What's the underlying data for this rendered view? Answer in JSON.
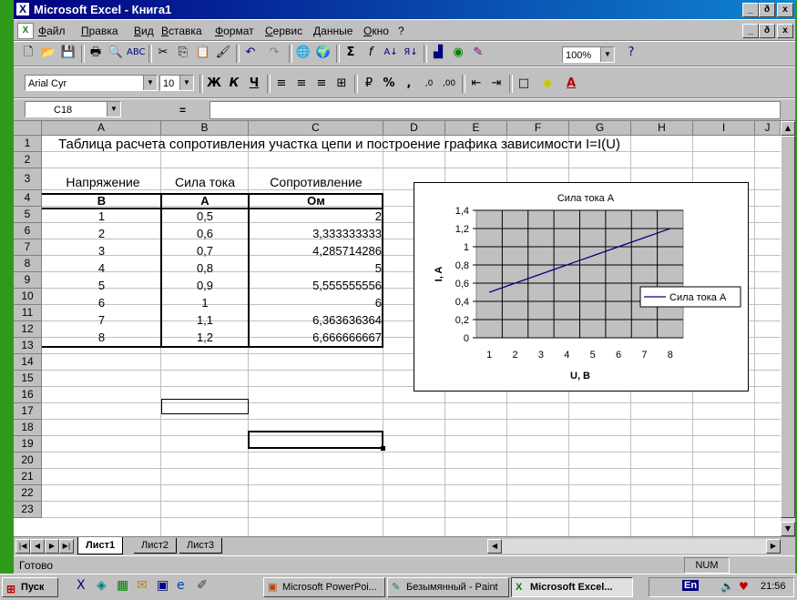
{
  "window": {
    "title": "Microsoft Excel - Книга1",
    "min": "_",
    "max": "ð",
    "close": "x"
  },
  "menu": [
    "Файл",
    "Правка",
    "Вид",
    "Вставка",
    "Формат",
    "Сервис",
    "Данные",
    "Окно",
    "?"
  ],
  "toolbar": {
    "zoom": "100%",
    "font": "Arial Cyr",
    "size": "10"
  },
  "formula_bar": {
    "name_box": "C18",
    "equals": "="
  },
  "columns": [
    "A",
    "B",
    "C",
    "D",
    "E",
    "F",
    "G",
    "H",
    "I",
    "J"
  ],
  "rows": [
    "1",
    "2",
    "3",
    "4",
    "5",
    "6",
    "7",
    "8",
    "9",
    "10",
    "11",
    "12",
    "13",
    "14",
    "15",
    "16",
    "17",
    "18",
    "19",
    "20",
    "21",
    "22",
    "23"
  ],
  "sheet": {
    "title": "Таблица расчета сопротивления участка цепи и построение графика зависимости I=I(U)",
    "headers": [
      "Напряжение",
      "Сила тока",
      "Сопротивление"
    ],
    "units": [
      "В",
      "А",
      "Ом"
    ],
    "data": [
      [
        "1",
        "0,5",
        "2"
      ],
      [
        "2",
        "0,6",
        "3,333333333"
      ],
      [
        "3",
        "0,7",
        "4,285714286"
      ],
      [
        "4",
        "0,8",
        "5"
      ],
      [
        "5",
        "0,9",
        "5,555555556"
      ],
      [
        "6",
        "1",
        "6"
      ],
      [
        "7",
        "1,1",
        "6,363636364"
      ],
      [
        "8",
        "1,2",
        "6,666666667"
      ]
    ]
  },
  "chart_data": {
    "type": "line",
    "title": "Сила тока А",
    "xlabel": "U, B",
    "ylabel": "I, A",
    "categories": [
      "1",
      "2",
      "3",
      "4",
      "5",
      "6",
      "7",
      "8"
    ],
    "series": [
      {
        "name": "Сила тока А",
        "values": [
          0.5,
          0.6,
          0.7,
          0.8,
          0.9,
          1,
          1.1,
          1.2
        ]
      }
    ],
    "y_ticks": [
      "0",
      "0,2",
      "0,4",
      "0,6",
      "0,8",
      "1",
      "1,2",
      "1,4"
    ],
    "ylim": [
      0,
      1.4
    ],
    "legend": "right",
    "plot_bg": "#c0c0c0",
    "line_color": "#000080"
  },
  "tabs": [
    "Лист1",
    "Лист2",
    "Лист3"
  ],
  "status": {
    "ready": "Готово",
    "num": "NUM"
  },
  "taskbar": {
    "start": "Пуск",
    "items": [
      "Microsoft PowerPoi...",
      "Безымянный - Paint",
      "Microsoft Excel..."
    ],
    "clock": "21:56",
    "lang": "En"
  }
}
